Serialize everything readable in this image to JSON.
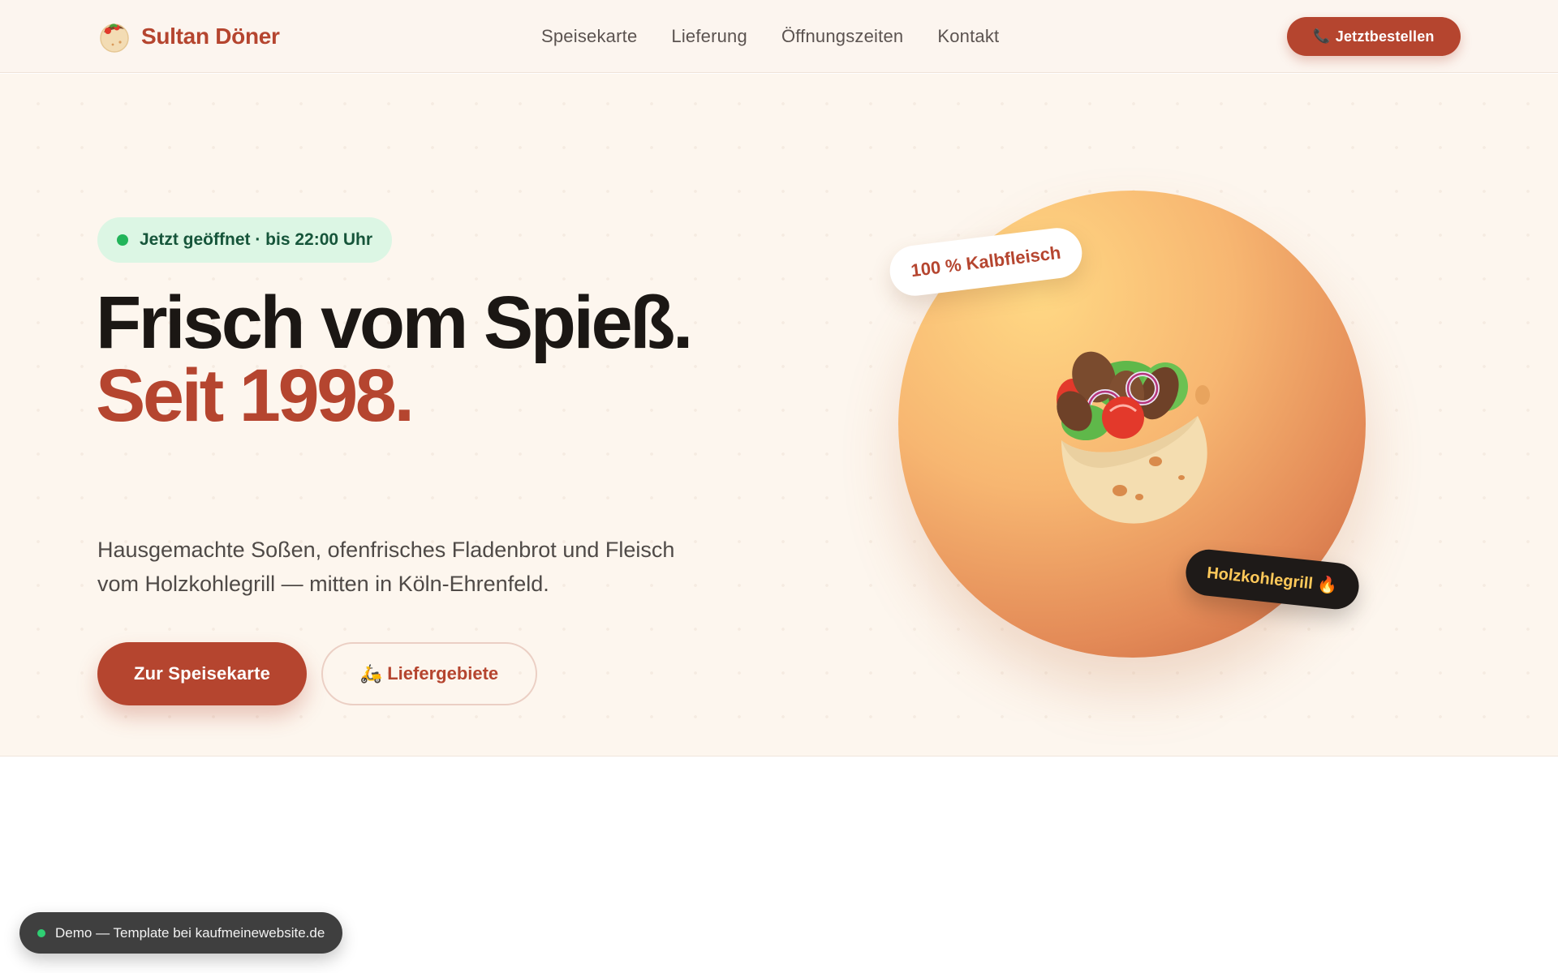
{
  "header": {
    "brand_name": "Sultan Döner",
    "nav": [
      {
        "label": "Speisekarte"
      },
      {
        "label": "Lieferung"
      },
      {
        "label": "Öffnungszeiten"
      },
      {
        "label": "Kontakt"
      }
    ],
    "cta_icon": "📞",
    "cta_label": "Jetztbestellen"
  },
  "hero": {
    "status": "Jetzt geöffnet · bis 22:00 Uhr",
    "headline_line1": "Frisch vom Spieß.",
    "headline_line2": "Seit 1998.",
    "description": "Hausgemachte Soßen, ofenfrisches Fladenbrot und Fleisch vom Holzkohlegrill — mitten in Köln-Ehrenfeld.",
    "primary_button": "Zur Speisekarte",
    "secondary_icon": "🛵",
    "secondary_button": "Liefergebiete",
    "tag_meat": "100 % Kalbfleisch",
    "tag_grill": "Holzkohlegrill 🔥"
  },
  "demo_badge": "Demo — Template bei kaufmeinewebsite.de",
  "icons": {
    "brand_logo": "doner-icon",
    "illustration": "doner-illustration",
    "status": "status-dot-icon",
    "cta": "phone-icon",
    "secondary": "scooter-icon"
  },
  "colors": {
    "accent": "#b5452f",
    "header_bg": "#fcf5ef",
    "hero_bg": "#fdf6ee",
    "status_bg": "#dcf6e4",
    "status_dot": "#22b45a",
    "status_text": "#16553a",
    "tag_dark_bg": "#1e1a18",
    "tag_dark_text": "#ffc95a",
    "demo_bg": "#3f3f3f"
  }
}
